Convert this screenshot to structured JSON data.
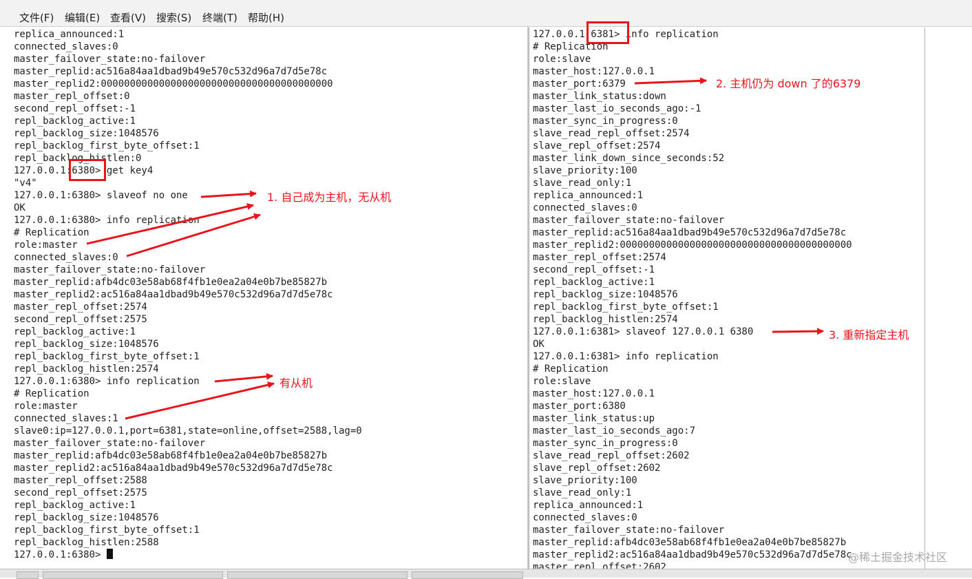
{
  "menu": [
    "文件(F)",
    "编辑(E)",
    "查看(V)",
    "搜索(S)",
    "终端(T)",
    "帮助(H)"
  ],
  "left_terminal": {
    "lines": [
      "replica_announced:1",
      "connected_slaves:0",
      "master_failover_state:no-failover",
      "master_replid:ac516a84aa1dbad9b49e570c532d96a7d7d5e78c",
      "master_replid2:0000000000000000000000000000000000000000",
      "master_repl_offset:0",
      "second_repl_offset:-1",
      "repl_backlog_active:1",
      "repl_backlog_size:1048576",
      "repl_backlog_first_byte_offset:1",
      "repl_backlog_histlen:0",
      "127.0.0.1:6380> get key4",
      "\"v4\"",
      "127.0.0.1:6380> slaveof no one",
      "OK",
      "127.0.0.1:6380> info replication",
      "# Replication",
      "role:master",
      "connected_slaves:0",
      "master_failover_state:no-failover",
      "master_replid:afb4dc03e58ab68f4fb1e0ea2a04e0b7be85827b",
      "master_replid2:ac516a84aa1dbad9b49e570c532d96a7d7d5e78c",
      "master_repl_offset:2574",
      "second_repl_offset:2575",
      "repl_backlog_active:1",
      "repl_backlog_size:1048576",
      "repl_backlog_first_byte_offset:1",
      "repl_backlog_histlen:2574",
      "127.0.0.1:6380> info replication",
      "# Replication",
      "role:master",
      "connected_slaves:1",
      "slave0:ip=127.0.0.1,port=6381,state=online,offset=2588,lag=0",
      "master_failover_state:no-failover",
      "master_replid:afb4dc03e58ab68f4fb1e0ea2a04e0b7be85827b",
      "master_replid2:ac516a84aa1dbad9b49e570c532d96a7d7d5e78c",
      "master_repl_offset:2588",
      "second_repl_offset:2575",
      "repl_backlog_active:1",
      "repl_backlog_size:1048576",
      "repl_backlog_first_byte_offset:1",
      "repl_backlog_histlen:2588"
    ],
    "prompt": "127.0.0.1:6380> "
  },
  "right_terminal": {
    "lines": [
      "127.0.0.1:6381> info replication",
      "# Replication",
      "role:slave",
      "master_host:127.0.0.1",
      "master_port:6379",
      "master_link_status:down",
      "master_last_io_seconds_ago:-1",
      "master_sync_in_progress:0",
      "slave_read_repl_offset:2574",
      "slave_repl_offset:2574",
      "master_link_down_since_seconds:52",
      "slave_priority:100",
      "slave_read_only:1",
      "replica_announced:1",
      "connected_slaves:0",
      "master_failover_state:no-failover",
      "master_replid:ac516a84aa1dbad9b49e570c532d96a7d7d5e78c",
      "master_replid2:0000000000000000000000000000000000000000",
      "master_repl_offset:2574",
      "second_repl_offset:-1",
      "repl_backlog_active:1",
      "repl_backlog_size:1048576",
      "repl_backlog_first_byte_offset:1",
      "repl_backlog_histlen:2574",
      "127.0.0.1:6381> slaveof 127.0.0.1 6380",
      "OK",
      "127.0.0.1:6381> info replication",
      "# Replication",
      "role:slave",
      "master_host:127.0.0.1",
      "master_port:6380",
      "master_link_status:up",
      "master_last_io_seconds_ago:7",
      "master_sync_in_progress:0",
      "slave_read_repl_offset:2602",
      "slave_repl_offset:2602",
      "slave_priority:100",
      "slave_read_only:1",
      "replica_announced:1",
      "connected_slaves:0",
      "master_failover_state:no-failover",
      "master_replid:afb4dc03e58ab68f4fb1e0ea2a04e0b7be85827b",
      "master_replid2:ac516a84aa1dbad9b49e570c532d96a7d7d5e78c",
      "master_repl_offset:2602"
    ]
  },
  "annotations": {
    "note1": "1. 自己成为主机，无从机",
    "note2": "2. 主机仍为 down 了的6379",
    "note3": "3. 重新指定主机",
    "note4": "有从机",
    "color": "#e8141c"
  },
  "watermark": "@稀土掘金技术社区"
}
